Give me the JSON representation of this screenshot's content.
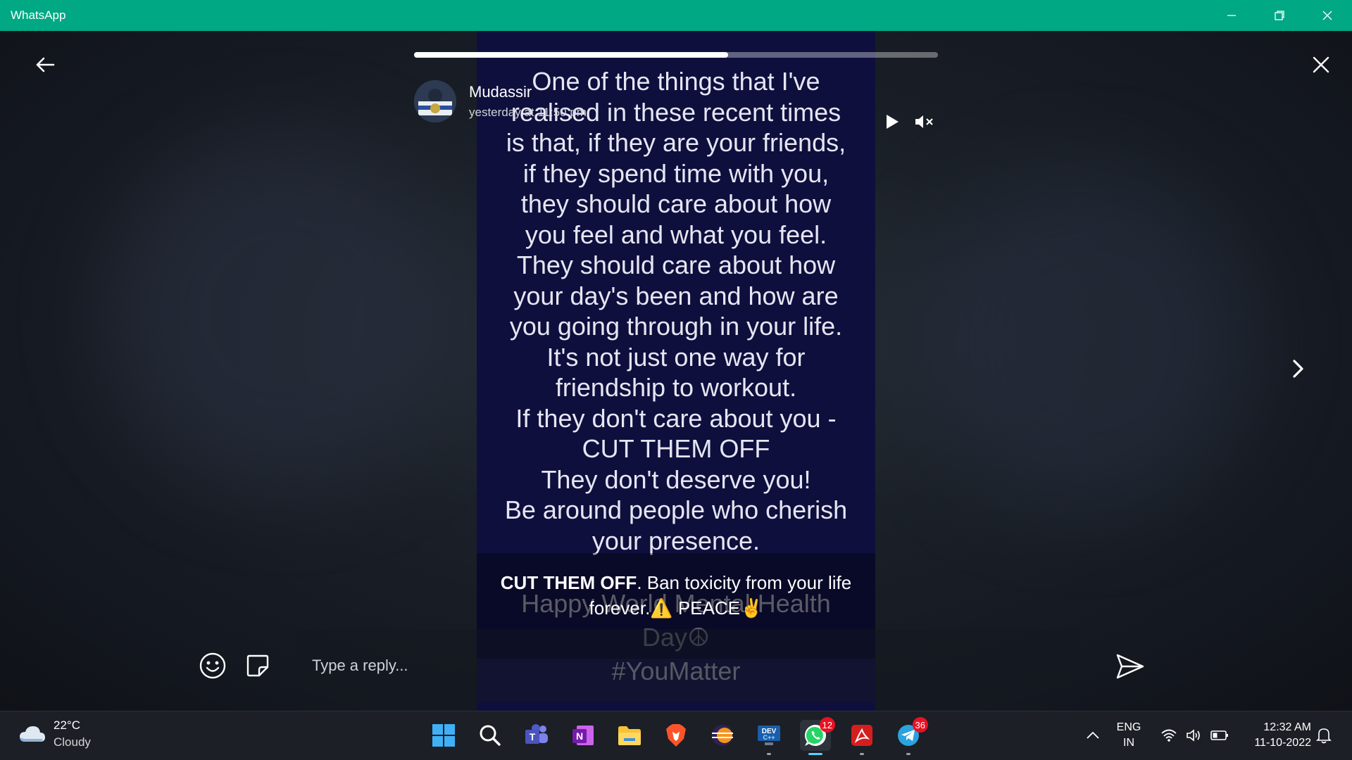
{
  "window": {
    "title": "WhatsApp"
  },
  "status": {
    "progress_percent": 60,
    "user_name": "Mudassir",
    "timestamp": "yesterday at 11:50 pm",
    "text_lines": [
      "One of the things that I've",
      "realised in these recent times",
      "is that, if they are your friends,",
      "if they spend time with you,",
      "they should care about how",
      "you feel and what you feel.",
      "They should care about how",
      "your day's been and how are",
      "you going through in your life.",
      "It's not just one way for",
      "friendship to workout.",
      "If they don't care about you -",
      "CUT THEM OFF",
      "They don't deserve you!",
      "Be around people who cherish",
      "your presence."
    ],
    "text_lines_lower": [
      "Happy World Mental Health",
      "Day☮",
      "#YouMatter"
    ],
    "caption_bold": "CUT THEM OFF",
    "caption_rest": ". Ban toxicity from your life forever.⚠️ PEACE✌️"
  },
  "reply": {
    "placeholder": "Type a reply..."
  },
  "taskbar": {
    "weather_temp": "22°C",
    "weather_cond": "Cloudy",
    "whatsapp_badge": "12",
    "telegram_badge": "36",
    "lang_line1": "ENG",
    "lang_line2": "IN",
    "time": "12:32 AM",
    "date": "11-10-2022"
  }
}
